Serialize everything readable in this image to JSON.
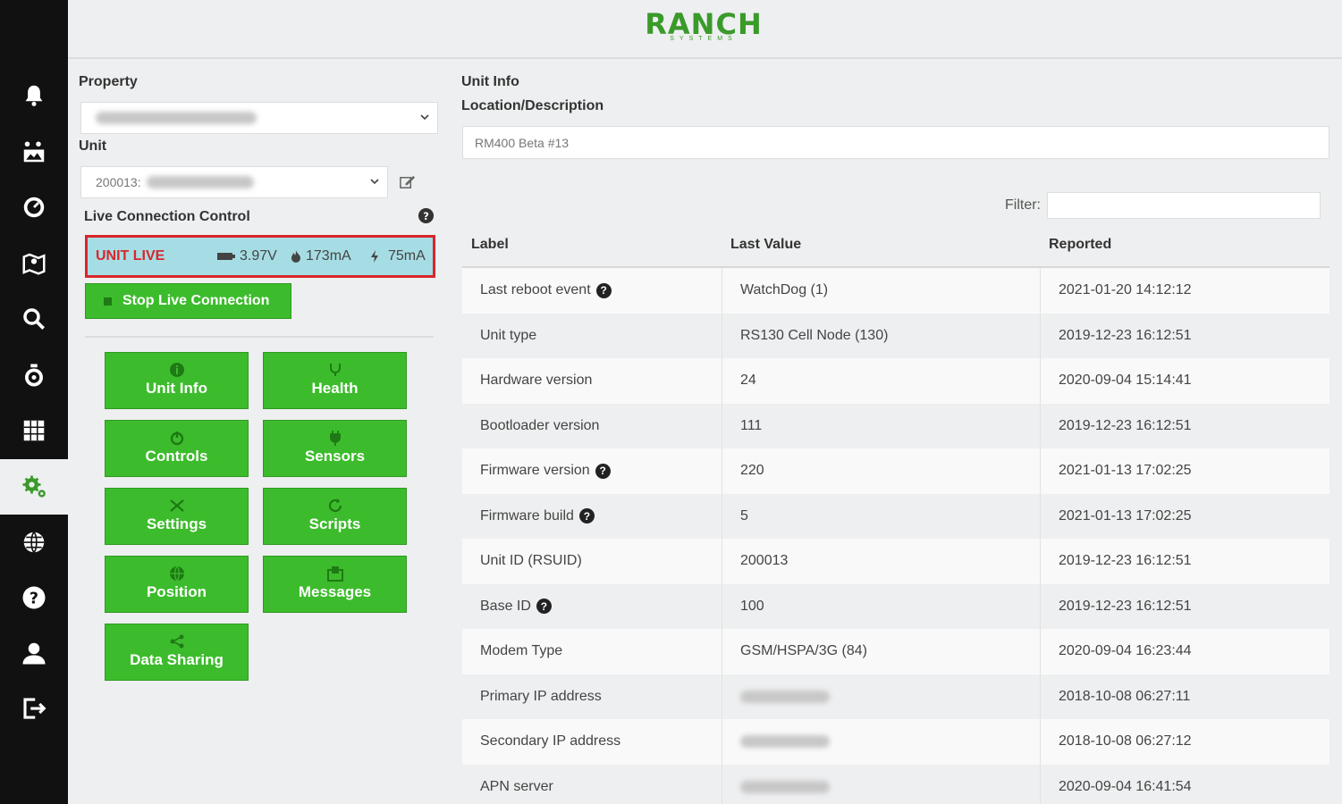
{
  "brand": {
    "name": "RANCH",
    "tagline": "SYSTEMS",
    "color": "#3a9a2a"
  },
  "sidebar": {
    "items": [
      {
        "icon": "bell-icon"
      },
      {
        "icon": "sensor-map-icon"
      },
      {
        "icon": "gauge-icon"
      },
      {
        "icon": "map-icon"
      },
      {
        "icon": "search-icon"
      },
      {
        "icon": "timer-icon"
      },
      {
        "icon": "report-grid-icon"
      },
      {
        "icon": "settings-gears-icon",
        "active": true
      },
      {
        "icon": "globe-icon"
      },
      {
        "icon": "help-icon"
      },
      {
        "icon": "user-icon"
      },
      {
        "icon": "logout-icon"
      }
    ]
  },
  "left": {
    "property_label": "Property",
    "unit_label": "Unit",
    "unit_value": "200013:",
    "live_label": "Live Connection Control",
    "live": {
      "status": "UNIT LIVE",
      "voltage": "3.97V",
      "current": "173mA",
      "power": "75mA"
    },
    "stop_button": "Stop Live Connection",
    "tiles": [
      {
        "label": "Unit Info",
        "icon": "info-icon"
      },
      {
        "label": "Health",
        "icon": "health-icon"
      },
      {
        "label": "Controls",
        "icon": "controls-icon"
      },
      {
        "label": "Sensors",
        "icon": "sensors-icon"
      },
      {
        "label": "Settings",
        "icon": "settings-icon"
      },
      {
        "label": "Scripts",
        "icon": "scripts-icon"
      },
      {
        "label": "Position",
        "icon": "position-icon"
      },
      {
        "label": "Messages",
        "icon": "messages-icon"
      },
      {
        "label": "Data Sharing",
        "icon": "share-icon"
      }
    ],
    "colors": {
      "tile_green": "#3cbc2c",
      "live_bg": "#a6dde4",
      "live_red": "#d9262b"
    }
  },
  "right": {
    "section_label": "Unit Info",
    "location_label": "Location/Description",
    "location_value": "RM400 Beta #13",
    "filter_label": "Filter:",
    "table": {
      "columns": [
        "Label",
        "Last Value",
        "Reported"
      ],
      "rows": [
        {
          "label": "Last reboot event",
          "help": true,
          "value": "WatchDog (1)",
          "reported": "2021-01-20 14:12:12"
        },
        {
          "label": "Unit type",
          "help": false,
          "value": "RS130 Cell Node (130)",
          "reported": "2019-12-23 16:12:51"
        },
        {
          "label": "Hardware version",
          "help": false,
          "value": "24",
          "reported": "2020-09-04 15:14:41"
        },
        {
          "label": "Bootloader version",
          "help": false,
          "value": "111",
          "reported": "2019-12-23 16:12:51"
        },
        {
          "label": "Firmware version",
          "help": true,
          "value": "220",
          "reported": "2021-01-13 17:02:25"
        },
        {
          "label": "Firmware build",
          "help": true,
          "value": "5",
          "reported": "2021-01-13 17:02:25"
        },
        {
          "label": "Unit ID (RSUID)",
          "help": false,
          "value": "200013",
          "reported": "2019-12-23 16:12:51"
        },
        {
          "label": "Base ID",
          "help": true,
          "value": "100",
          "reported": "2019-12-23 16:12:51"
        },
        {
          "label": "Modem Type",
          "help": false,
          "value": "GSM/HSPA/3G (84)",
          "reported": "2020-09-04 16:23:44"
        },
        {
          "label": "Primary IP address",
          "help": false,
          "value": "",
          "blurred": true,
          "reported": "2018-10-08 06:27:11"
        },
        {
          "label": "Secondary IP address",
          "help": false,
          "value": "",
          "blurred": true,
          "reported": "2018-10-08 06:27:12"
        },
        {
          "label": "APN server",
          "help": false,
          "value": "",
          "blurred": true,
          "reported": "2020-09-04 16:41:54"
        }
      ]
    }
  }
}
